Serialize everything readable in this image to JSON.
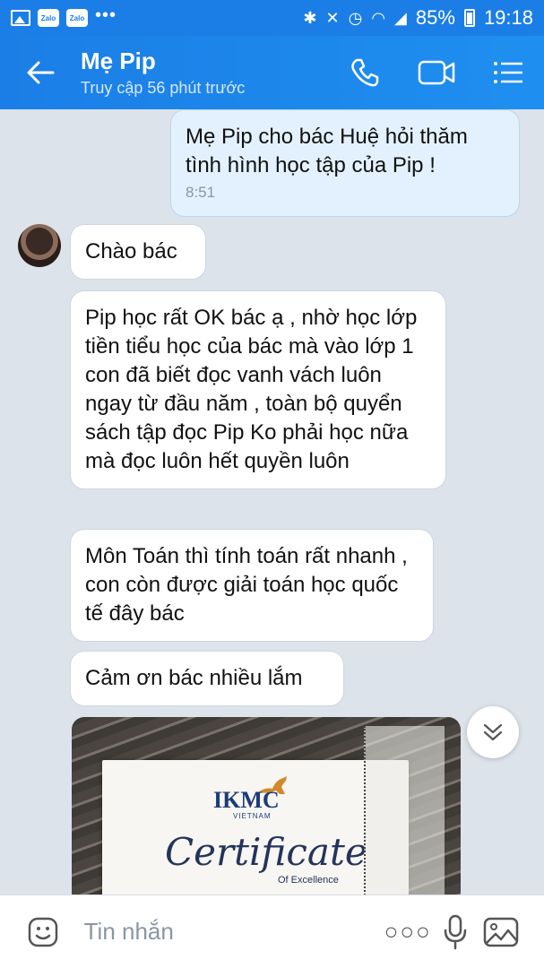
{
  "status_bar": {
    "battery": "85%",
    "time": "19:18",
    "notification_icons": [
      "photo-icon",
      "zalo-icon",
      "zalo-icon",
      "more-icon"
    ],
    "zalo_label": "Zalo"
  },
  "header": {
    "contact_name": "Mẹ Pip",
    "contact_status": "Truy cập 56 phút trước"
  },
  "messages": [
    {
      "type": "sent",
      "text": "Mẹ Pip cho bác Huệ hỏi thăm tình hình học tập của Pip !",
      "time": "8:51"
    },
    {
      "type": "received",
      "text": "Chào  bác"
    },
    {
      "type": "received",
      "text": "Pip học rất OK bác ạ , nhờ học lớp tiền tiểu học của bác mà vào lớp 1 con đã biết đọc vanh vách luôn ngay từ đầu năm , toàn bộ quyển sách tập đọc Pip Ko phải học nữa mà đọc luôn hết quyền luôn"
    },
    {
      "type": "received",
      "text": "Môn Toán thì tính toán rất nhanh , con còn được giải toán học quốc tế đây bác"
    },
    {
      "type": "received",
      "text": "Cảm ơn bác nhiều lắm"
    }
  ],
  "image_message": {
    "logo": "IKMC",
    "logo_sub": "VIETNAM",
    "title": "Certificate",
    "subtitle": "Of Excellence"
  },
  "input": {
    "placeholder": "Tin nhắn"
  },
  "colors": {
    "header": "#1b7ee6",
    "background": "#dde3ea",
    "sent_bubble": "#e3f1fe",
    "received_bubble": "#ffffff"
  }
}
